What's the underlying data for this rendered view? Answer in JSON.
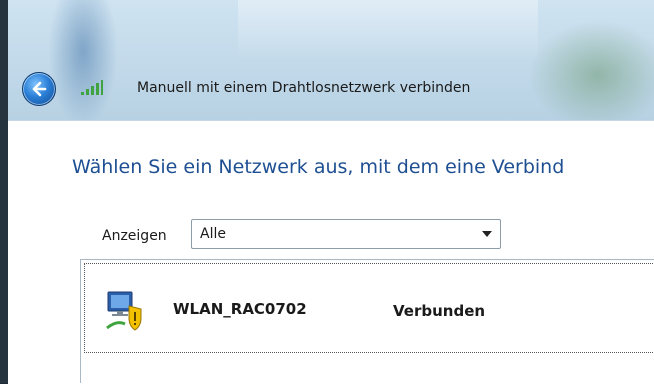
{
  "window": {
    "title": "Manuell mit einem Drahtlosnetzwerk verbinden"
  },
  "icons": {
    "back": "back-arrow-icon",
    "wifi": "wifi-signal-icon",
    "network": "network-security-icon",
    "dropdown": "chevron-down-icon"
  },
  "main": {
    "heading": "Wählen Sie ein Netzwerk aus, mit dem eine Verbind",
    "filter": {
      "label": "Anzeigen",
      "selected": "Alle"
    },
    "networks": [
      {
        "name": "WLAN_RAC0702",
        "status": "Verbunden"
      }
    ]
  },
  "colors": {
    "heading": "#1e4f92",
    "accent": "#2b7fd6"
  }
}
